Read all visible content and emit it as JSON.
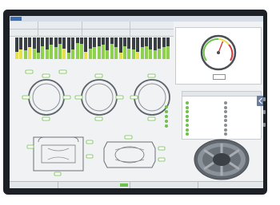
{
  "colors": {
    "bezel": "#1d2024",
    "screen_background": "#f1f2f3",
    "menu_bar": "#d6dde6",
    "menu_active": "#3b6db3",
    "bar_green": "#8fd14f",
    "bar_yellow": "#e6e04a",
    "bar_dark": "#3a3f44",
    "status_green": "#6cc24a",
    "gauge_needle": "#d13a3a",
    "side_button": "#6a7ea0"
  },
  "bar_strip": {
    "levels": [
      0.35,
      0.45,
      0.4,
      0.55,
      0.5,
      0.3,
      0.6,
      0.45,
      0.65,
      0.55,
      0.7,
      0.5,
      0.3,
      0.45,
      0.75,
      0.7,
      0.35,
      0.5,
      0.55,
      0.6,
      0.65,
      0.4,
      0.7,
      0.55,
      0.3,
      0.6,
      0.5,
      0.45,
      0.35,
      0.55,
      0.6,
      0.45,
      0.4,
      0.5,
      0.55,
      0.6
    ],
    "colors": [
      "yellow",
      "yellow",
      "green",
      "yellow",
      "green",
      "green",
      "green",
      "green",
      "green",
      "green",
      "green",
      "yellow",
      "green",
      "green",
      "green",
      "green",
      "yellow",
      "green",
      "green",
      "green",
      "green",
      "green",
      "green",
      "green",
      "yellow",
      "green",
      "green",
      "green",
      "yellow",
      "green",
      "green",
      "green",
      "green",
      "green",
      "green",
      "green"
    ]
  },
  "menu_tabs": [
    "",
    "",
    ""
  ],
  "gauge": {
    "title": "",
    "readout": "",
    "needle_level": 0.58
  },
  "legend": {
    "title": "",
    "left_header": "",
    "right_header": "",
    "left_items": [
      "",
      "",
      "",
      "",
      "",
      "",
      "",
      ""
    ],
    "right_items": [
      "",
      "",
      "",
      "",
      "",
      "",
      "",
      ""
    ],
    "left_colors": [
      "#6cc24a",
      "#6cc24a",
      "#6cc24a",
      "#6cc24a",
      "#6cc24a",
      "#6cc24a",
      "#6cc24a",
      "#6cc24a"
    ],
    "right_colors": [
      "#8a8f94",
      "#8a8f94",
      "#8a8f94",
      "#8a8f94",
      "#8a8f94",
      "#8a8f94",
      "#8a8f94",
      "#8a8f94"
    ]
  },
  "bearing_status_items": [
    "",
    "",
    "",
    "",
    ""
  ],
  "bottom_bar": {
    "left_label": "",
    "middle_label": "",
    "right_label": ""
  },
  "logo_text": ""
}
